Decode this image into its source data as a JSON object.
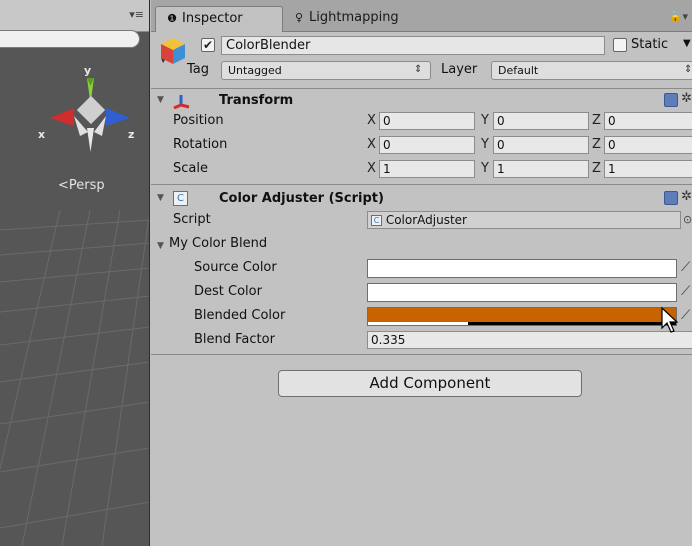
{
  "scene": {
    "persp_label": "Persp",
    "gizmo": {
      "axis_y": "y",
      "axis_x": "x",
      "axis_z": "z"
    },
    "menu_icon": "menu-icon"
  },
  "tabs": {
    "inspector": "Inspector",
    "lightmapping": "Lightmapping"
  },
  "object": {
    "name": "ColorBlender",
    "active": true,
    "static_label": "Static",
    "static": false,
    "tag_label": "Tag",
    "tag_value": "Untagged",
    "layer_label": "Layer",
    "layer_value": "Default"
  },
  "transform": {
    "title": "Transform",
    "rows": [
      {
        "label": "Position",
        "x": "0",
        "y": "0",
        "z": "0"
      },
      {
        "label": "Rotation",
        "x": "0",
        "y": "0",
        "z": "0"
      },
      {
        "label": "Scale",
        "x": "1",
        "y": "1",
        "z": "1"
      }
    ],
    "axis_x": "X",
    "axis_y": "Y",
    "axis_z": "Z"
  },
  "script_component": {
    "title": "Color Adjuster (Script)",
    "script_label": "Script",
    "script_value": "ColorAdjuster",
    "group_label": "My Color Blend",
    "source_label": "Source Color",
    "dest_label": "Dest Color",
    "blended_label": "Blended Color",
    "factor_label": "Blend Factor",
    "factor_value": "0.335",
    "source_color": "#ffffff",
    "dest_color": "#ffffff",
    "blended_color": "#c86400"
  },
  "add_component_label": "Add Component"
}
